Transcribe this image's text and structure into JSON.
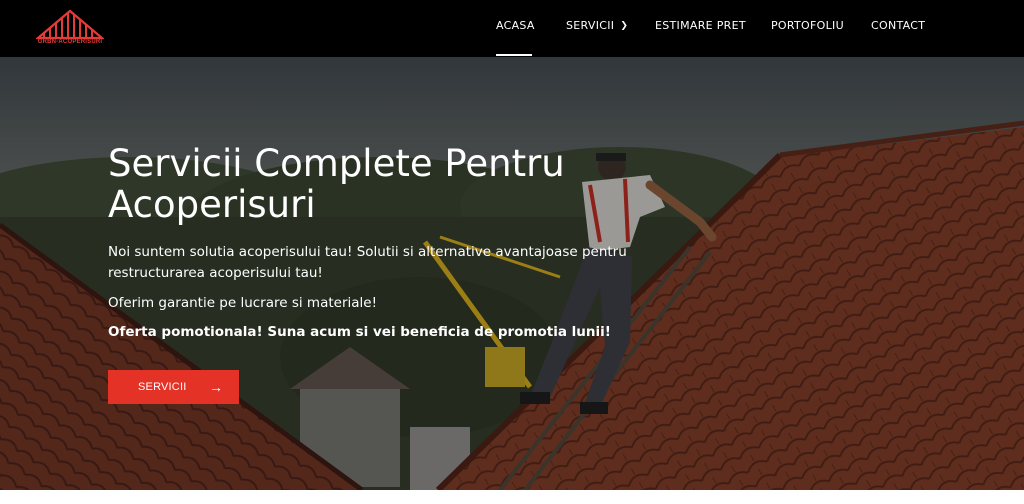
{
  "brand": {
    "logo_text": "GRBN-ACOPERISURI",
    "accent_color": "#e53226"
  },
  "nav": {
    "items": [
      {
        "label": "ACASA",
        "active": true
      },
      {
        "label": "SERVICII",
        "has_dropdown": true
      },
      {
        "label": "ESTIMARE PRET"
      },
      {
        "label": "PORTOFOLIU"
      },
      {
        "label": "CONTACT"
      }
    ],
    "dropdown_icon": "chevron-down-icon"
  },
  "hero": {
    "title_line1": "Servicii Complete Pentru",
    "title_line2": "Acoperisuri",
    "paragraph1": "Noi suntem solutia acoperisului tau! Solutii si alternative avantajoase pentru restructurarea acoperisului tau!",
    "paragraph2": "Oferim garantie pe lucrare si materiale!",
    "paragraph3": "Oferta pomotionala! Suna acum si vei beneficia de promotia lunii!",
    "cta_label": "SERVICII",
    "cta_icon": "arrow-right-icon"
  }
}
